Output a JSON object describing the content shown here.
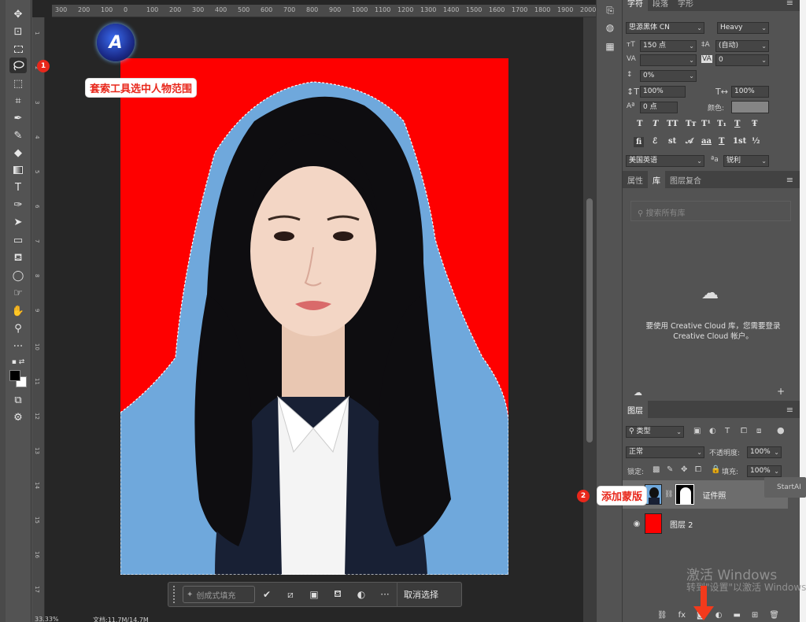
{
  "canvas": {
    "ruler_top_ticks": [
      "300",
      "200",
      "100",
      "0",
      "100",
      "200",
      "300",
      "400",
      "500",
      "600",
      "700",
      "800",
      "900",
      "1000",
      "1100",
      "1200",
      "1300",
      "1400",
      "1500",
      "1600",
      "1700",
      "1800",
      "1900",
      "2000"
    ],
    "ruler_left_ticks": [
      "1",
      "2",
      "3",
      "4",
      "5",
      "6",
      "7",
      "8",
      "9",
      "10",
      "11",
      "12",
      "13",
      "14",
      "15",
      "16",
      "17"
    ],
    "background_color": "#fe0000",
    "selection_color": "#6fa8dc"
  },
  "annotations": {
    "step1_number": "1",
    "step1_label": "套索工具选中人物范围",
    "step2_number": "2",
    "step2_label": "添加蒙版",
    "logo_letter": "A"
  },
  "context_bar": {
    "generative_fill_label": "创成式填充",
    "more_label": "···",
    "deselect_label": "取消选择"
  },
  "status_bar": {
    "zoom": "33.33%",
    "doc_info": "文档:11.7M/14.7M"
  },
  "character_panel": {
    "tabs": [
      "字符",
      "段落",
      "字形"
    ],
    "font_family": "思源黑体 CN",
    "font_style": "Heavy",
    "font_size": "150 点",
    "leading": "(自动)",
    "kerning": "",
    "tracking": "0",
    "baseline_shift": "0%",
    "vertical_scale": "100%",
    "horizontal_scale": "100%",
    "tsume": "0 点",
    "color_label": "颜色:",
    "color_value": "#858585",
    "style_glyphs": [
      "T",
      "T",
      "TT",
      "Tт",
      "T¹",
      "T₁",
      "T",
      "Ŧ"
    ],
    "opentype_glyphs": [
      "fi",
      "ℰ",
      "st",
      "𝒜",
      "aa",
      "T",
      "1st",
      "½"
    ],
    "language": "美国英语",
    "aa_label": "ªa",
    "antialias": "锐利"
  },
  "library_panel": {
    "tabs": [
      "属性",
      "库",
      "图层复合"
    ],
    "search_placeholder": "搜索所有库",
    "message": "要使用 Creative Cloud 库，您需要登录 Creative Cloud 帐户。"
  },
  "layers_panel": {
    "title": "图层",
    "filter_kind": "类型",
    "blend_mode": "正常",
    "opacity_label": "不透明度:",
    "opacity_value": "100%",
    "lock_label": "锁定:",
    "fill_label": "填充:",
    "fill_value": "100%",
    "layers": [
      {
        "name": "证件照",
        "visible": true,
        "has_mask": true,
        "selected": true
      },
      {
        "name": "图层 2",
        "visible": true,
        "has_mask": false,
        "selected": false,
        "thumb_color": "#fe0000"
      }
    ],
    "bottom_icons": [
      "link-icon",
      "fx-icon",
      "add-mask-icon",
      "adjustment-icon",
      "folder-icon",
      "new-layer-icon",
      "trash-icon"
    ],
    "fx_label": "fx"
  },
  "overlay": {
    "startai_label": "StartAI",
    "watermark_line1": "激活 Windows",
    "watermark_line2": "转到\"设置\"以激活 Windows"
  }
}
